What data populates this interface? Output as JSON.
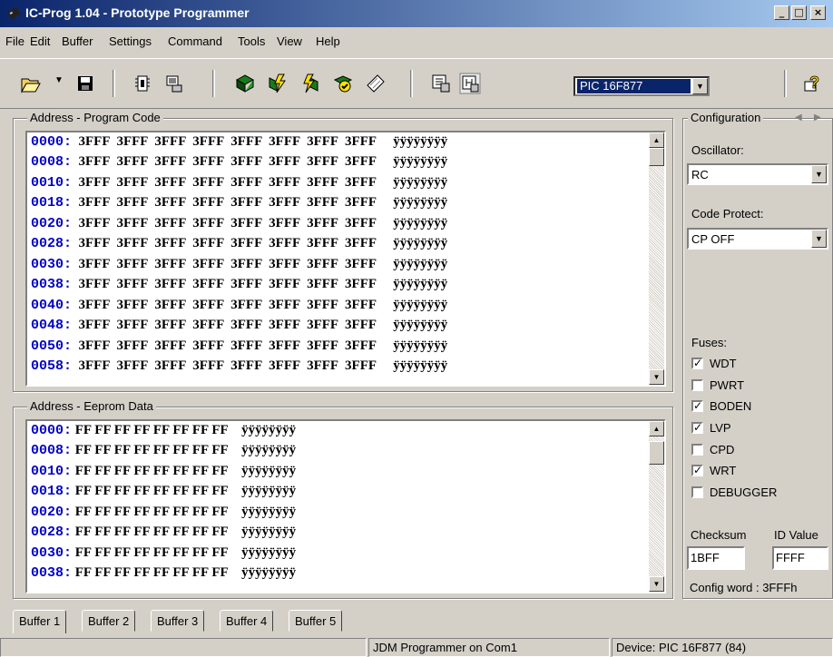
{
  "window": {
    "title": "IC-Prog 1.04 - Prototype Programmer",
    "controls": [
      "_",
      "□",
      "×"
    ]
  },
  "menu": {
    "items": [
      "File",
      "Edit",
      "Buffer",
      "Settings",
      "Command",
      "Tools",
      "View",
      "Help"
    ]
  },
  "toolbar": {
    "device": "PIC 16F877"
  },
  "program_code": {
    "label": "Address - Program Code",
    "rows": [
      {
        "addr": "0000:",
        "words": "3FFF  3FFF  3FFF  3FFF  3FFF  3FFF  3FFF  3FFF",
        "ascii": "ÿÿÿÿÿÿÿÿ"
      },
      {
        "addr": "0008:",
        "words": "3FFF  3FFF  3FFF  3FFF  3FFF  3FFF  3FFF  3FFF",
        "ascii": "ÿÿÿÿÿÿÿÿ"
      },
      {
        "addr": "0010:",
        "words": "3FFF  3FFF  3FFF  3FFF  3FFF  3FFF  3FFF  3FFF",
        "ascii": "ÿÿÿÿÿÿÿÿ"
      },
      {
        "addr": "0018:",
        "words": "3FFF  3FFF  3FFF  3FFF  3FFF  3FFF  3FFF  3FFF",
        "ascii": "ÿÿÿÿÿÿÿÿ"
      },
      {
        "addr": "0020:",
        "words": "3FFF  3FFF  3FFF  3FFF  3FFF  3FFF  3FFF  3FFF",
        "ascii": "ÿÿÿÿÿÿÿÿ"
      },
      {
        "addr": "0028:",
        "words": "3FFF  3FFF  3FFF  3FFF  3FFF  3FFF  3FFF  3FFF",
        "ascii": "ÿÿÿÿÿÿÿÿ"
      },
      {
        "addr": "0030:",
        "words": "3FFF  3FFF  3FFF  3FFF  3FFF  3FFF  3FFF  3FFF",
        "ascii": "ÿÿÿÿÿÿÿÿ"
      },
      {
        "addr": "0038:",
        "words": "3FFF  3FFF  3FFF  3FFF  3FFF  3FFF  3FFF  3FFF",
        "ascii": "ÿÿÿÿÿÿÿÿ"
      },
      {
        "addr": "0040:",
        "words": "3FFF  3FFF  3FFF  3FFF  3FFF  3FFF  3FFF  3FFF",
        "ascii": "ÿÿÿÿÿÿÿÿ"
      },
      {
        "addr": "0048:",
        "words": "3FFF  3FFF  3FFF  3FFF  3FFF  3FFF  3FFF  3FFF",
        "ascii": "ÿÿÿÿÿÿÿÿ"
      },
      {
        "addr": "0050:",
        "words": "3FFF  3FFF  3FFF  3FFF  3FFF  3FFF  3FFF  3FFF",
        "ascii": "ÿÿÿÿÿÿÿÿ"
      },
      {
        "addr": "0058:",
        "words": "3FFF  3FFF  3FFF  3FFF  3FFF  3FFF  3FFF  3FFF",
        "ascii": "ÿÿÿÿÿÿÿÿ"
      }
    ]
  },
  "eeprom": {
    "label": "Address - Eeprom Data",
    "rows": [
      {
        "addr": "0000:",
        "bytes": "FF FF FF FF FF FF FF FF",
        "ascii": "ÿÿÿÿÿÿÿÿ"
      },
      {
        "addr": "0008:",
        "bytes": "FF FF FF FF FF FF FF FF",
        "ascii": "ÿÿÿÿÿÿÿÿ"
      },
      {
        "addr": "0010:",
        "bytes": "FF FF FF FF FF FF FF FF",
        "ascii": "ÿÿÿÿÿÿÿÿ"
      },
      {
        "addr": "0018:",
        "bytes": "FF FF FF FF FF FF FF FF",
        "ascii": "ÿÿÿÿÿÿÿÿ"
      },
      {
        "addr": "0020:",
        "bytes": "FF FF FF FF FF FF FF FF",
        "ascii": "ÿÿÿÿÿÿÿÿ"
      },
      {
        "addr": "0028:",
        "bytes": "FF FF FF FF FF FF FF FF",
        "ascii": "ÿÿÿÿÿÿÿÿ"
      },
      {
        "addr": "0030:",
        "bytes": "FF FF FF FF FF FF FF FF",
        "ascii": "ÿÿÿÿÿÿÿÿ"
      },
      {
        "addr": "0038:",
        "bytes": "FF FF FF FF FF FF FF FF",
        "ascii": "ÿÿÿÿÿÿÿÿ"
      }
    ]
  },
  "config": {
    "label": "Configuration",
    "oscillator_label": "Oscillator:",
    "oscillator": "RC",
    "code_protect_label": "Code Protect:",
    "code_protect": "CP OFF",
    "fuses_label": "Fuses:",
    "fuses": [
      {
        "name": "WDT",
        "checked": true
      },
      {
        "name": "PWRT",
        "checked": false
      },
      {
        "name": "BODEN",
        "checked": true
      },
      {
        "name": "LVP",
        "checked": true
      },
      {
        "name": "CPD",
        "checked": false
      },
      {
        "name": "WRT",
        "checked": true
      },
      {
        "name": "DEBUGGER",
        "checked": false
      }
    ],
    "checksum_label": "Checksum",
    "checksum": "1BFF",
    "id_label": "ID Value",
    "id_value": "FFFF",
    "config_word": "Config word : 3FFFh"
  },
  "tabs": [
    "Buffer 1",
    "Buffer 2",
    "Buffer 3",
    "Buffer 4",
    "Buffer 5"
  ],
  "status": {
    "left": "",
    "programmer": "JDM Programmer on Com1",
    "device": "Device: PIC 16F877  (84)"
  }
}
